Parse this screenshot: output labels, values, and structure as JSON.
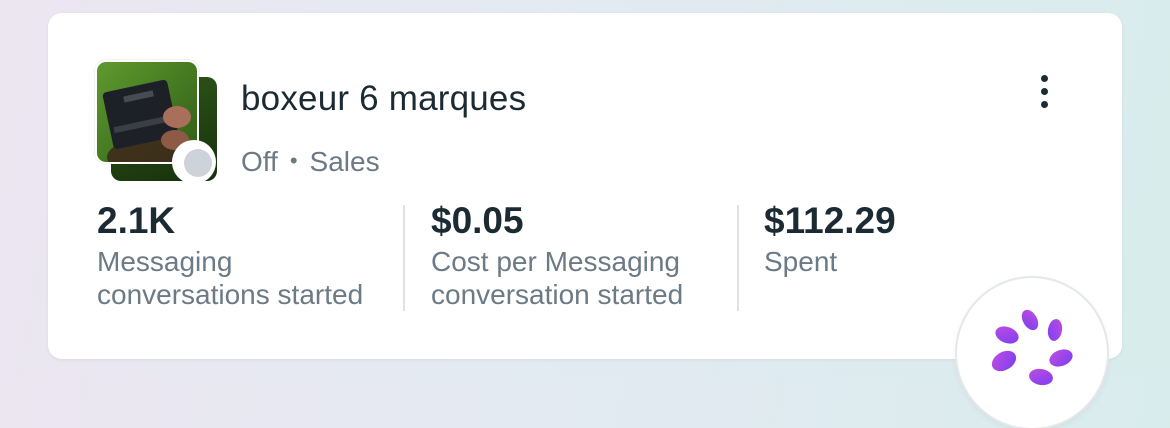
{
  "campaign": {
    "title": "boxeur 6 marques",
    "status": "Off",
    "separator": "•",
    "objective": "Sales"
  },
  "metrics": [
    {
      "value": "2.1K",
      "label_line1": "Messaging",
      "label_line2": "conversations started"
    },
    {
      "value": "$0.05",
      "label_line1": "Cost per Messaging",
      "label_line2": "conversation started"
    },
    {
      "value": "$112.29",
      "label_line1": "Spent",
      "label_line2": ""
    }
  ],
  "icons": {
    "more": "more-vertical-icon",
    "assistant": "ai-assistant-icon"
  },
  "colors": {
    "text_primary": "#1c2b33",
    "text_secondary": "#6c7a86",
    "status_off": "#cdd3da",
    "assistant_gradient": [
      "#7b3ff2",
      "#c04de0"
    ]
  }
}
